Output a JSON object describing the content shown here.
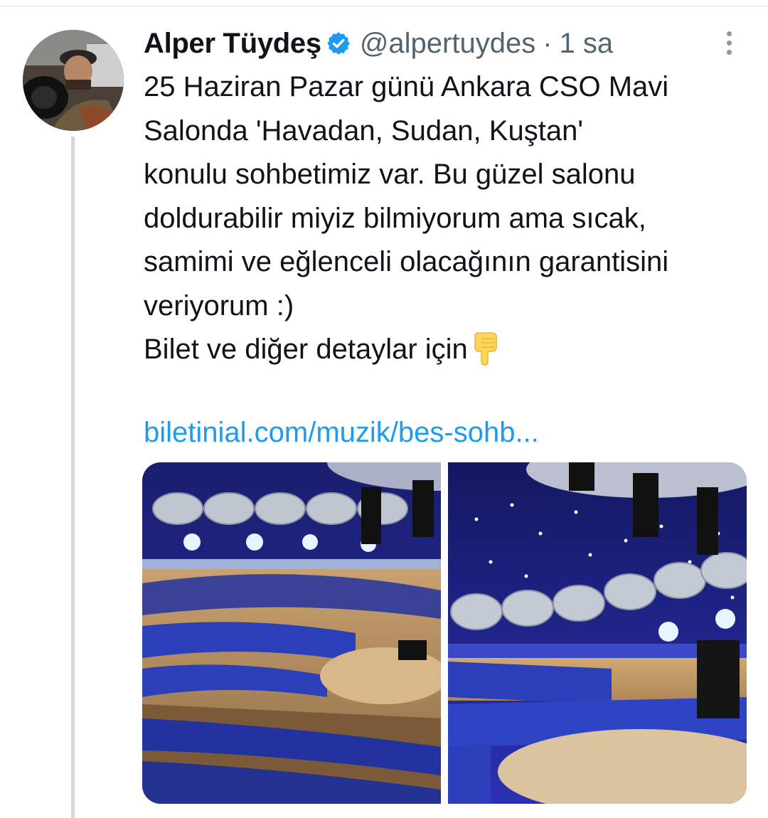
{
  "tweet": {
    "author": {
      "name": "Alper Tüydeş",
      "handle": "@alpertuydes",
      "verified": true
    },
    "separator": "·",
    "time": "1 sa",
    "text_lines": [
      "25 Haziran Pazar günü Ankara CSO Mavi",
      "Salonda 'Havadan, Sudan, Kuştan'",
      "konulu sohbetimiz var. Bu güzel salonu",
      "doldurabilir miyiz bilmiyorum ama sıcak,",
      "samimi ve eğlenceli olacağının garantisini",
      "veriyorum :)",
      "Bilet ve diğer detaylar için"
    ],
    "emoji": "backhand-index-pointing-down",
    "link": "biletinial.com/muzik/bes-sohb...",
    "media": [
      {
        "alt_icon": "concert-hall-photo"
      },
      {
        "alt_icon": "concert-hall-photo"
      }
    ]
  },
  "colors": {
    "link": "#1d9bf0",
    "verified": "#1d9bf0",
    "secondary_text": "#536471",
    "thread_line": "#cfd9de"
  }
}
